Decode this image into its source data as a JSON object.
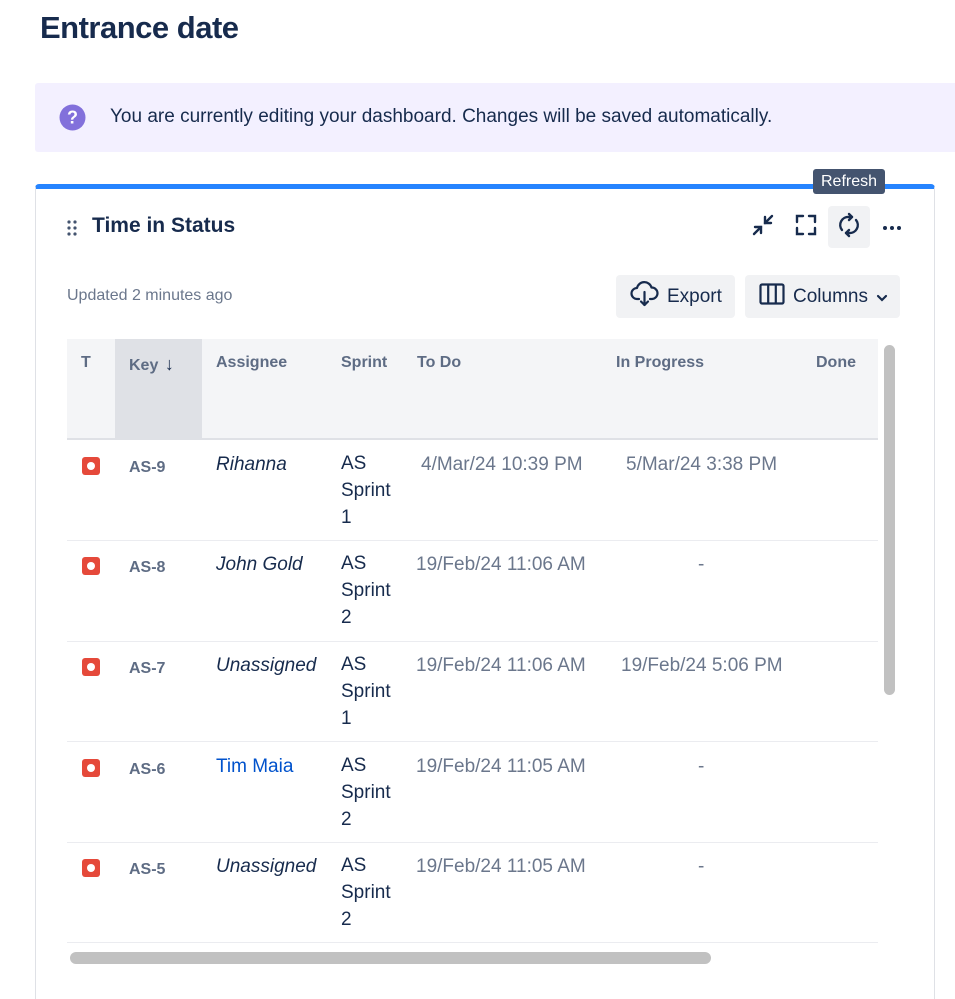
{
  "page": {
    "title": "Entrance date"
  },
  "banner": {
    "icon": "question-circle-icon",
    "text": "You are currently editing your dashboard. Changes will be saved automatically."
  },
  "tooltip": {
    "text": "Refresh"
  },
  "gadget": {
    "title": "Time in Status",
    "updated": "Updated 2 minutes ago",
    "accent_color": "#2684ff",
    "header_icons": [
      "drag-handle-icon",
      "minimize-icon",
      "fullscreen-icon",
      "refresh-icon",
      "more-icon"
    ],
    "toolbar": {
      "export_label": "Export",
      "export_icon": "cloud-download-icon",
      "columns_label": "Columns",
      "columns_icon": "columns-icon"
    },
    "table": {
      "columns": [
        "T",
        "Key",
        "Assignee",
        "Sprint",
        "To Do",
        "In Progress",
        "Done"
      ],
      "sort_indicator": "↓",
      "rows": [
        {
          "type": "bug",
          "key": "AS-9",
          "assignee": "Rihanna",
          "assignee_link": false,
          "sprint": "AS Sprint 1",
          "todo": "4/Mar/24 10:39 PM",
          "in_progress": "5/Mar/24 3:38 PM",
          "done": ""
        },
        {
          "type": "bug",
          "key": "AS-8",
          "assignee": "John Gold",
          "assignee_link": false,
          "sprint": "AS Sprint 2",
          "todo": "19/Feb/24 11:06 AM",
          "in_progress": "-",
          "done": ""
        },
        {
          "type": "bug",
          "key": "AS-7",
          "assignee": "Unassigned",
          "assignee_link": false,
          "sprint": "AS Sprint 1",
          "todo": "19/Feb/24 11:06 AM",
          "in_progress": "19/Feb/24 5:06 PM",
          "done": ""
        },
        {
          "type": "bug",
          "key": "AS-6",
          "assignee": "Tim Maia",
          "assignee_link": true,
          "sprint": "AS Sprint 2",
          "todo": "19/Feb/24 11:05 AM",
          "in_progress": "-",
          "done": ""
        },
        {
          "type": "bug",
          "key": "AS-5",
          "assignee": "Unassigned",
          "assignee_link": false,
          "sprint": "AS Sprint 2",
          "todo": "19/Feb/24 11:05 AM",
          "in_progress": "-",
          "done": ""
        }
      ]
    }
  }
}
